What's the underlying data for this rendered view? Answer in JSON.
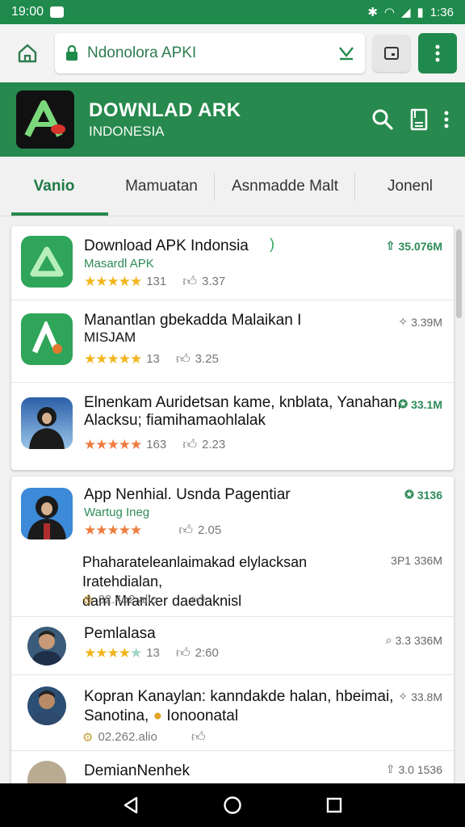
{
  "status": {
    "time": "19:00",
    "clock": "1:36"
  },
  "browser": {
    "url": "Ndonolora APKI"
  },
  "app": {
    "title": "DOWNLAD ARK",
    "subtitle": "INDONESIA"
  },
  "tabs": [
    "Vanio",
    "Mamuatan",
    "Asnmadde Malt",
    "Jonenl"
  ],
  "card1": [
    {
      "title": "Download APK Indonsia",
      "sub": "Masardl APK",
      "rating": "131",
      "likes": "3.37",
      "size": "35.076M"
    },
    {
      "title": "Manantlan gbekadda Malaikan I",
      "title2": "MISJAM",
      "rating": "13",
      "likes": "3.25",
      "size": "3.39M"
    },
    {
      "title": "Elnenkam Auridetsan kame, knblata, Yanahan,",
      "title2": "Alacksu; fiamihamaohlalak",
      "rating": "163",
      "likes": "2.23",
      "size": "33.1M"
    }
  ],
  "card2": [
    {
      "title": "App Nenhial. Usnda Pagentiar",
      "sub": "Wartug Ineg",
      "likes": "2.05",
      "size": "3136",
      "desc1": "Phaharateleanlaimakad elylacksan Iratehdialan,",
      "desc2": "dam Mranker daedaknisl",
      "desc_size": "3P1 336M",
      "views": "32.4o2.alio"
    },
    {
      "title": "Pemlalasa",
      "rating": "13",
      "likes": "2:60",
      "size": "3.3 336M"
    },
    {
      "title": "Kopran Kanaylan: kanndakde halan, hbeimai,",
      "title2": "Sanotina,",
      "title2b": "Ionoonatal",
      "views": "02.262.alio",
      "size": "33.8M"
    },
    {
      "title": "DemianNenhek",
      "size": "3.0 1536"
    }
  ],
  "colors": {
    "brand": "#27894d",
    "accent": "#2e8b57",
    "star": "#f2b51c"
  }
}
